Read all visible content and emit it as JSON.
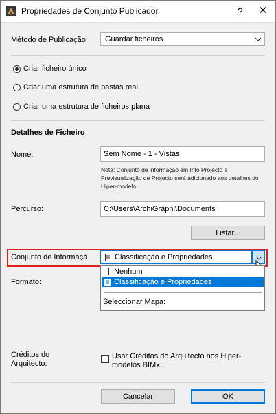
{
  "window": {
    "title": "Propriedades de Conjunto Publicador",
    "help_label": "?",
    "close_label": "✕"
  },
  "publish_method": {
    "label": "Método de Publicação:",
    "value": "Guardar ficheiros"
  },
  "options": [
    {
      "label": "Criar ficheiro único",
      "selected": true
    },
    {
      "label": "Criar uma estrutura de pastas real",
      "selected": false
    },
    {
      "label": "Criar uma estrutura de ficheiros plana",
      "selected": false
    }
  ],
  "file_details": {
    "heading": "Detalhes de Ficheiro",
    "name_label": "Nome:",
    "name_value": "Sem Nome - 1 - Vistas",
    "note": "Nota: Conjunto de informação em Info Projecto e Previsualização de Projecto será adicionado aos detalhes do Hiper-modelo.",
    "path_label": "Percurso:",
    "path_value": "C:\\Users\\ArchiGraphi\\Documents",
    "browse_label": "Listar..."
  },
  "info_set": {
    "label": "Conjunto de Informaçã",
    "value": "Classificação e Propriedades",
    "dropdown": {
      "items": [
        {
          "label": "Nenhum",
          "selected": false
        },
        {
          "label": "Classificação e Propriedades",
          "selected": true
        }
      ],
      "map_label": "Seleccionar Mapa:"
    }
  },
  "format": {
    "label": "Formato:"
  },
  "credits": {
    "label": "Créditos do Arquitecto:",
    "checkbox_label": "Usar Créditos do Arquitecto nos Hiper-modelos BIMx.",
    "checked": false
  },
  "buttons": {
    "cancel": "Cancelar",
    "ok": "OK"
  },
  "colors": {
    "highlight": "#e02020",
    "selection": "#0078d7"
  }
}
